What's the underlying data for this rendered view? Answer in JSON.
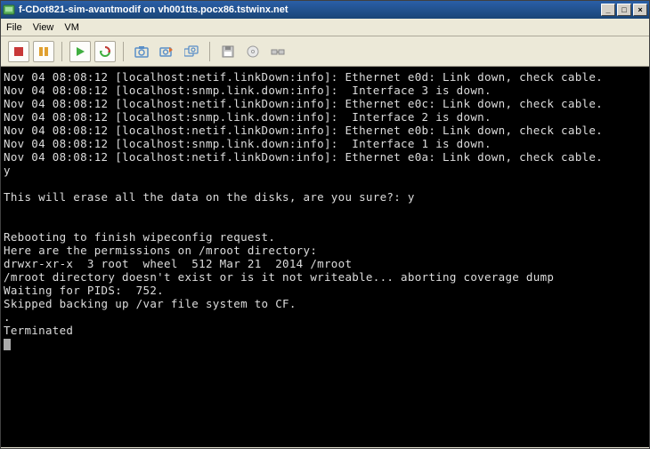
{
  "window": {
    "title": "f-CDot821-sim-avantmodif on vh001tts.pocx86.tstwinx.net"
  },
  "menu": {
    "file": "File",
    "view": "View",
    "vm": "VM"
  },
  "console_lines": [
    "Nov 04 08:08:12 [localhost:netif.linkDown:info]: Ethernet e0d: Link down, check cable.",
    "Nov 04 08:08:12 [localhost:snmp.link.down:info]:  Interface 3 is down.",
    "Nov 04 08:08:12 [localhost:netif.linkDown:info]: Ethernet e0c: Link down, check cable.",
    "Nov 04 08:08:12 [localhost:snmp.link.down:info]:  Interface 2 is down.",
    "Nov 04 08:08:12 [localhost:netif.linkDown:info]: Ethernet e0b: Link down, check cable.",
    "Nov 04 08:08:12 [localhost:snmp.link.down:info]:  Interface 1 is down.",
    "Nov 04 08:08:12 [localhost:netif.linkDown:info]: Ethernet e0a: Link down, check cable.",
    "y",
    "",
    "This will erase all the data on the disks, are you sure?: y",
    "",
    "",
    "Rebooting to finish wipeconfig request.",
    "Here are the permissions on /mroot directory:",
    "drwxr-xr-x  3 root  wheel  512 Mar 21  2014 /mroot",
    "/mroot directory doesn't exist or is it not writeable... aborting coverage dump",
    "Waiting for PIDS:  752.",
    "Skipped backing up /var file system to CF.",
    ".",
    "Terminated"
  ]
}
